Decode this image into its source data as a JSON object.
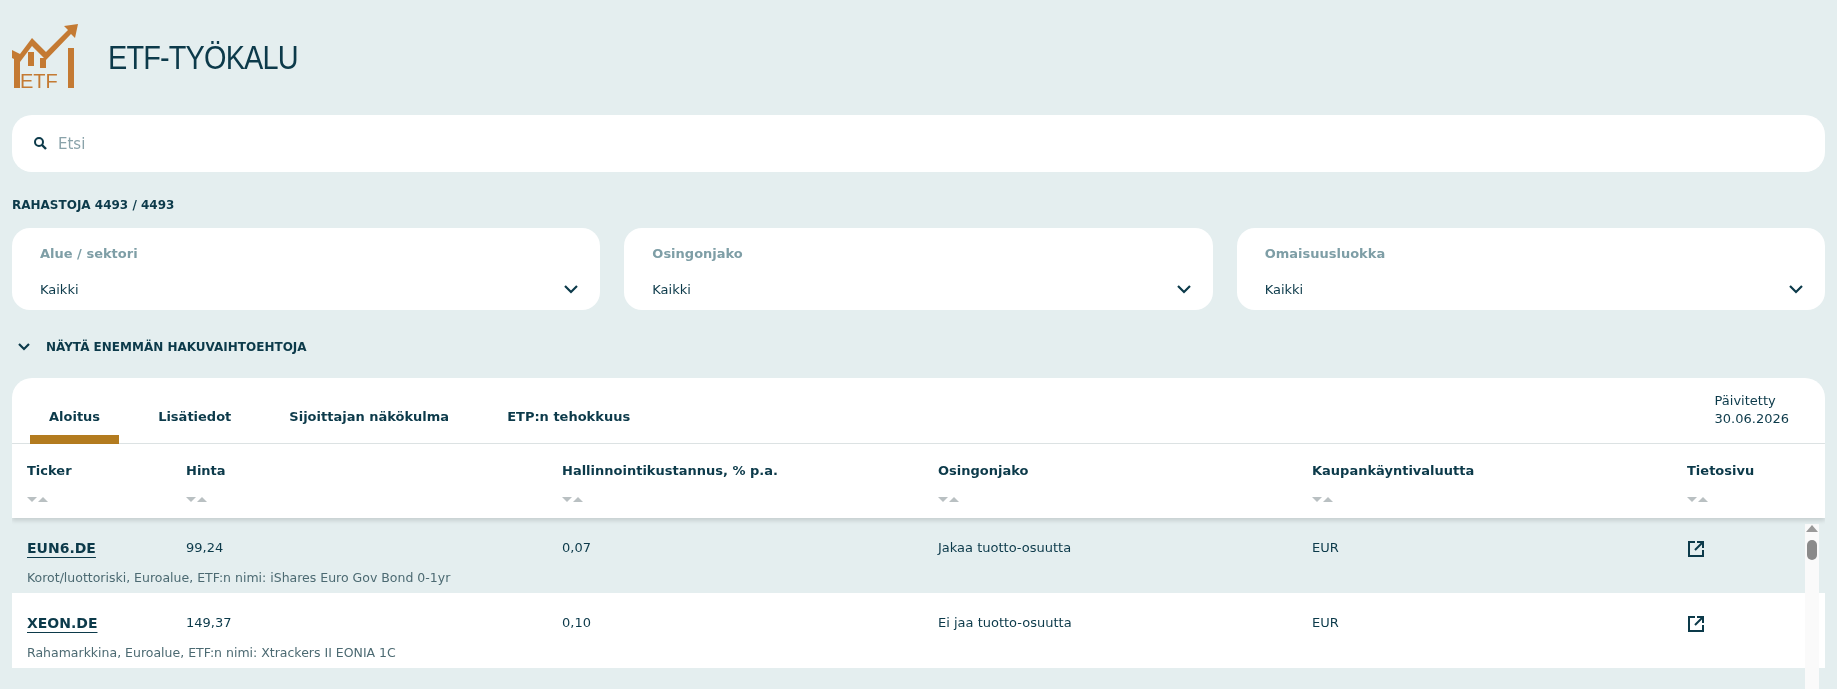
{
  "header": {
    "logo_text": "ETF",
    "title": "ETF-TYÖKALU"
  },
  "search": {
    "placeholder": "Etsi"
  },
  "fund_count": "RAHASTOJA 4493 / 4493",
  "filters": [
    {
      "label": "Alue / sektori",
      "value": "Kaikki"
    },
    {
      "label": "Osingonjako",
      "value": "Kaikki"
    },
    {
      "label": "Omaisuusluokka",
      "value": "Kaikki"
    }
  ],
  "more_options": "NÄYTÄ ENEMMÄN HAKUVAIHTOEHTOJA",
  "tabs": [
    {
      "label": "Aloitus",
      "selected": true
    },
    {
      "label": "Lisätiedot",
      "selected": false
    },
    {
      "label": "Sijoittajan näkökulma",
      "selected": false
    },
    {
      "label": "ETP:n tehokkuus",
      "selected": false
    }
  ],
  "updated": {
    "label": "Päivitetty",
    "date": "30.06.2026"
  },
  "table": {
    "columns": [
      "Ticker",
      "Hinta",
      "Hallinnointikustannus, % p.a.",
      "Osingonjako",
      "Kaupankäyntivaluutta",
      "Tietosivu"
    ],
    "rows": [
      {
        "ticker": "EUN6.DE",
        "price": "99,24",
        "fee": "0,07",
        "dividend": "Jakaa tuotto-osuutta",
        "currency": "EUR",
        "description": "Korot/luottoriski, Euroalue, ETF:n nimi: iShares Euro Gov Bond 0-1yr"
      },
      {
        "ticker": "XEON.DE",
        "price": "149,37",
        "fee": "0,10",
        "dividend": "Ei jaa tuotto-osuutta",
        "currency": "EUR",
        "description": "Rahamarkkina, Euroalue, ETF:n nimi: Xtrackers II EONIA 1C"
      }
    ]
  }
}
